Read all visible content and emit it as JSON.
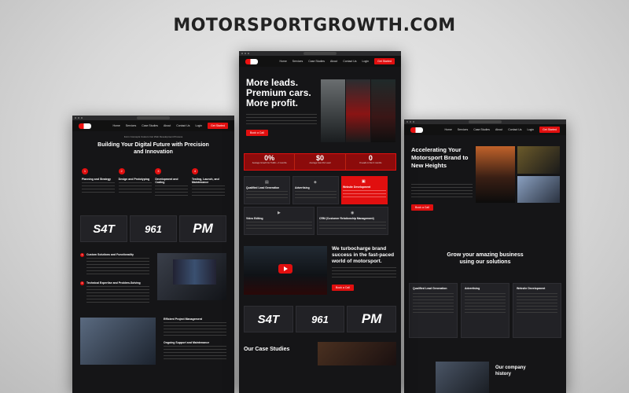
{
  "page": {
    "headline": "MOTORSPORTGROWTH.COM"
  },
  "colors": {
    "accent": "#e10f0f",
    "bg": "#151517"
  },
  "left_window": {
    "nav": [
      "Home",
      "Services",
      "Case Studies",
      "About",
      "Contact Us",
      "Login"
    ],
    "nav_cta": "Get Started",
    "eyebrow": "Form Concepts Custom Car Web Development Process",
    "hero_title": "Building Your Digital Future with Precision and Innovation",
    "steps": [
      {
        "num": "1",
        "title": "Planning and Strategy"
      },
      {
        "num": "2",
        "title": "Design and Prototyping"
      },
      {
        "num": "3",
        "title": "Development and Coding"
      },
      {
        "num": "4",
        "title": "Testing, Launch, and Maintenance"
      }
    ],
    "logos": [
      "S4T",
      "961",
      "PM"
    ],
    "features": [
      {
        "num": "1",
        "title": "Custom Solutions and Functionality"
      },
      {
        "num": "2",
        "title": "Technical Expertise and Problem-Solving"
      }
    ],
    "features2": [
      {
        "title": "Efficient Project Management"
      },
      {
        "title": "Ongoing Support and Maintenance"
      }
    ]
  },
  "center_window": {
    "nav": [
      "Home",
      "Services",
      "Case Studies",
      "About",
      "Contact Us",
      "Login"
    ],
    "nav_cta": "Get Started",
    "hero_title": "More leads. Premium cars. More profit.",
    "hero_btn": "Book a Call",
    "stats": [
      {
        "value": "0%",
        "label": "Average Growth for Traffic + 3 months"
      },
      {
        "value": "$0",
        "label": "Average Cost Per Lead"
      },
      {
        "value": "0",
        "label": "# Leads in first 3 months"
      }
    ],
    "services": [
      {
        "title": "Qualified Lead Generation",
        "highlight": false
      },
      {
        "title": "Advertising",
        "highlight": false
      },
      {
        "title": "Website Development",
        "highlight": true
      },
      {
        "title": "Video Editing",
        "highlight": false
      },
      {
        "title": "CRM (Customer Relationship Management)",
        "highlight": false
      }
    ],
    "video_title": "We turbocharge brand success in the fast-paced world of motorsport.",
    "video_btn": "Book a Call",
    "logos": [
      "S4T",
      "961",
      "PM"
    ],
    "case_title": "Our Case Studies"
  },
  "right_window": {
    "nav": [
      "Home",
      "Services",
      "Case Studies",
      "About",
      "Contact Us",
      "Login"
    ],
    "nav_cta": "Get Started",
    "hero_title": "Accelerating Your Motorsport Brand to New Heights",
    "hero_btn": "Book a Call",
    "grow_title": "Grow your amazing business using our solutions",
    "cards": [
      {
        "title": "Qualified Lead Generation"
      },
      {
        "title": "Advertising"
      },
      {
        "title": "Website Development"
      }
    ],
    "history_title": "Our company history"
  }
}
